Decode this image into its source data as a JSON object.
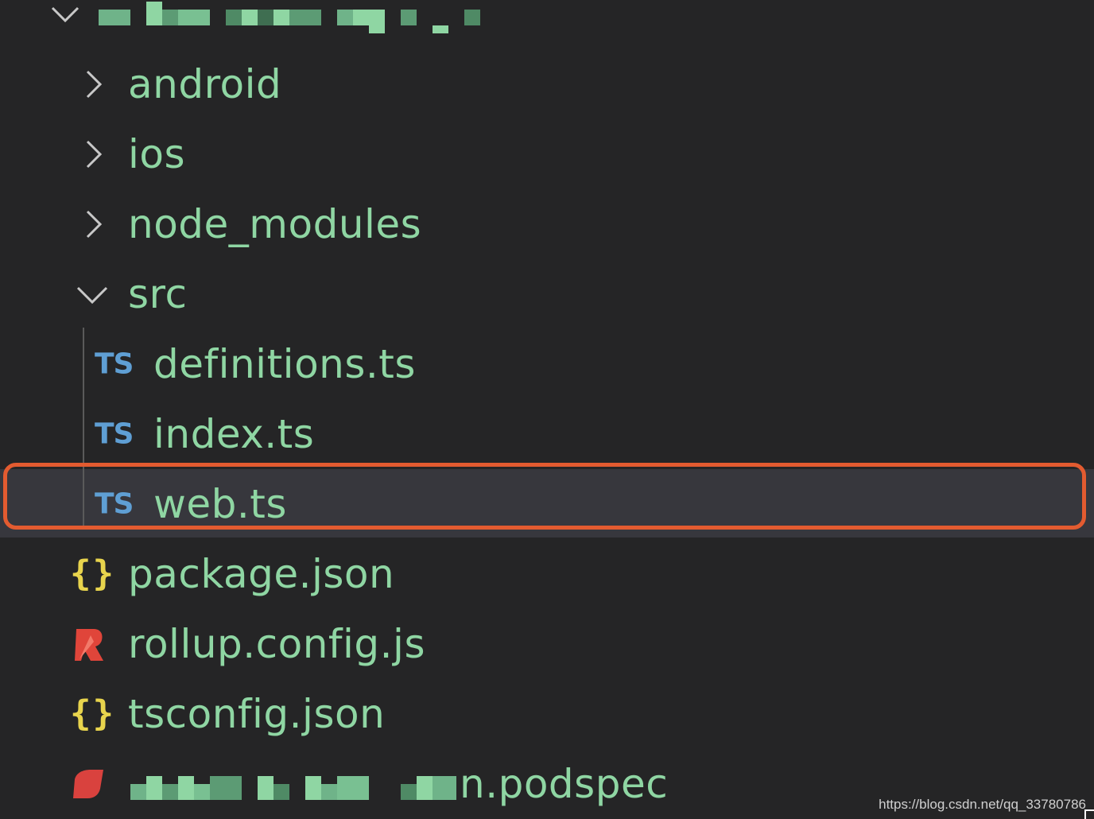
{
  "explorer": {
    "root": {
      "expanded": true,
      "name_obscured": true
    },
    "items": [
      {
        "label": "android",
        "kind": "folder",
        "expanded": false
      },
      {
        "label": "ios",
        "kind": "folder",
        "expanded": false
      },
      {
        "label": "node_modules",
        "kind": "folder",
        "expanded": false
      },
      {
        "label": "src",
        "kind": "folder",
        "expanded": true
      },
      {
        "label": "definitions.ts",
        "kind": "ts-file",
        "icon_text": "TS"
      },
      {
        "label": "index.ts",
        "kind": "ts-file",
        "icon_text": "TS"
      },
      {
        "label": "web.ts",
        "kind": "ts-file",
        "icon_text": "TS",
        "selected": true
      },
      {
        "label": "package.json",
        "kind": "json-file",
        "icon_text": "{}"
      },
      {
        "label": "rollup.config.js",
        "kind": "rollup-file"
      },
      {
        "label": "tsconfig.json",
        "kind": "json-file",
        "icon_text": "{}"
      },
      {
        "label": "n.podspec",
        "kind": "podspec-file",
        "name_partially_obscured": true
      }
    ]
  },
  "watermark": "https://blog.csdn.net/qq_33780786",
  "colors": {
    "background": "#252526",
    "label_text": "#8fd6a3",
    "ts_icon": "#5f9fd4",
    "json_icon": "#e8d44d",
    "rollup_icon": "#e0453a",
    "podspec_icon": "#d9423e",
    "highlight_border": "#e35b30",
    "selected_background": "#37373d"
  }
}
